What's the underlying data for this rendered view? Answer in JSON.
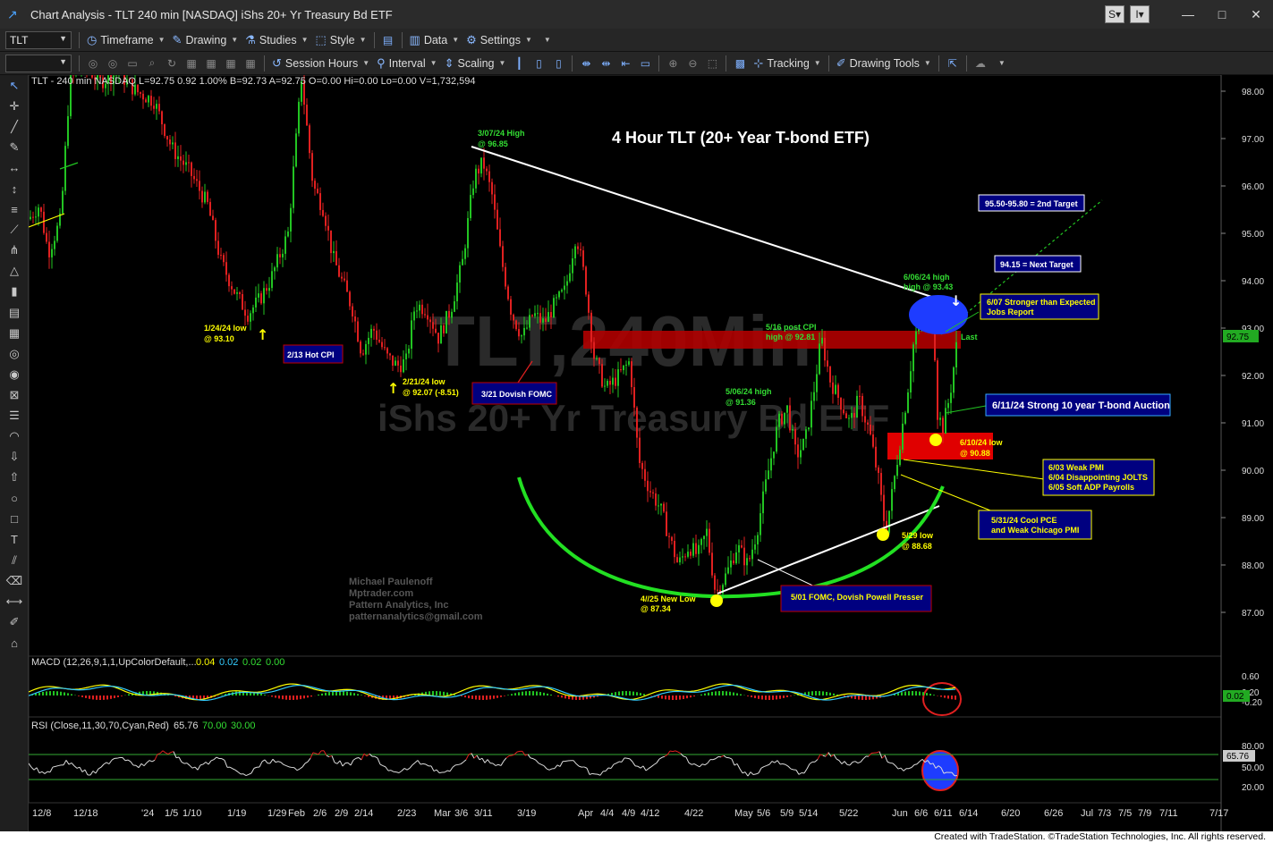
{
  "window": {
    "title": "Chart Analysis - TLT 240 min [NASDAQ] iShs 20+ Yr Treasury Bd ETF",
    "btn_s": "S",
    "btn_i": "I",
    "minimize": "—",
    "maximize": "□",
    "close": "✕"
  },
  "toolbar1": {
    "symbol": "TLT",
    "timeframe": "Timeframe",
    "drawing": "Drawing",
    "studies": "Studies",
    "style": "Style",
    "data": "Data",
    "settings": "Settings"
  },
  "toolbar2": {
    "session_hours": "Session Hours",
    "interval": "Interval",
    "scaling": "Scaling",
    "tracking": "Tracking",
    "drawing_tools": "Drawing Tools"
  },
  "chart": {
    "header": "TLT - 240 min  NASDAQ  L=92.75  0.92  1.00%  B=92.73  A=92.75  O=0.00  Hi=0.00  Lo=0.00  V=1,732,594",
    "watermark_symbol": "TLT,240Min",
    "watermark_name": "iShs 20+ Yr Treasury Bd ETF",
    "title": "4 Hour TLT (20+ Year T-bond ETF)",
    "author_lines": [
      "Michael Paulenoff",
      "Mptrader.com",
      "Pattern Analytics, Inc",
      "patternanalytics@gmail.com"
    ],
    "last_label": "Last",
    "last_price": "92.75",
    "macd_header": "MACD (12,26,9,1,1,UpColorDefault,...",
    "macd_values": [
      "0.04",
      "0.02",
      "0.02",
      "0.00"
    ],
    "macd_last": "0.02",
    "rsi_header": "RSI (Close,11,30,70,Cyan,Red)",
    "rsi_values": [
      "65.76",
      "70.00",
      "30.00"
    ],
    "rsi_last": "65.76",
    "colors": {
      "up": "#22c422",
      "down": "#e02020",
      "annotation_box": "#000080",
      "annotation_text_yellow": "#ffff00",
      "annotation_text_green": "#33dd33",
      "resistance_zone": "#c00000",
      "rounding_bottom": "#22e022",
      "circle_blue": "#1e3cff"
    },
    "annotations": {
      "high_0307": [
        "3/07/24 High",
        "@ 96.85"
      ],
      "low_0124": [
        "1/24/24 low",
        "@ 93.10"
      ],
      "hot_cpi": "2/13 Hot CPI",
      "low_0221": [
        "2/21/24 low",
        "@ 92.07 (-8.51)"
      ],
      "dovish_fomc_321": "3/21 Dovish FOMC",
      "high_0506": [
        "5/06/24 high",
        "@ 91.36"
      ],
      "post_cpi_0516": [
        "5/16 post CPI",
        "high @ 92.81"
      ],
      "high_0606": [
        "6/06/24 high",
        "high @ 93.43"
      ],
      "target2": "95.50-95.80 = 2nd Target",
      "next_target": "94.15 = Next Target",
      "jobs_report": [
        "6/07 Stronger than Expected",
        "Jobs Report"
      ],
      "auction": "6/11/24 Strong 10 year T-bond Auction",
      "low_0610": [
        "6/10/24 low",
        "@ 90.88"
      ],
      "weak_data": [
        "6/03 Weak PMI",
        "6/04 Disappointing JOLTS",
        "6/05 Soft ADP Payrolls"
      ],
      "pce": [
        "5/31/24 Cool PCE",
        "and Weak Chicago PMI"
      ],
      "low_0529": [
        "5/29 low",
        "@ 88.68"
      ],
      "new_low_0425": [
        "4//25 New Low",
        "@ 87.34"
      ],
      "fomc_0501": "5/01 FOMC, Dovish Powell Presser"
    }
  },
  "price_axis": {
    "labels": [
      "98.00",
      "97.00",
      "96.00",
      "95.00",
      "94.00",
      "93.00",
      "92.00",
      "91.00",
      "90.00",
      "89.00",
      "88.00",
      "87.00"
    ]
  },
  "macd_axis": {
    "labels": [
      "0.60",
      "0.20",
      "-0.20"
    ]
  },
  "rsi_axis": {
    "labels": [
      "80.00",
      "50.00",
      "20.00"
    ]
  },
  "date_axis": {
    "labels": [
      "12/8",
      "12/18",
      "'24",
      "1/5",
      "1/10",
      "1/19",
      "1/29",
      "Feb",
      "2/6",
      "2/9",
      "2/14",
      "2/23",
      "Mar",
      "3/6",
      "3/11",
      "3/19",
      "Apr",
      "4/4",
      "4/9",
      "4/12",
      "4/22",
      "May",
      "5/6",
      "5/9",
      "5/14",
      "5/22",
      "Jun",
      "6/6",
      "6/11",
      "6/14",
      "6/20",
      "6/26",
      "Jul",
      "7/3",
      "7/5",
      "7/9",
      "7/11",
      "7/17"
    ]
  },
  "status": {
    "footer": "Created with TradeStation. ©TradeStation Technologies, Inc. All rights reserved."
  }
}
